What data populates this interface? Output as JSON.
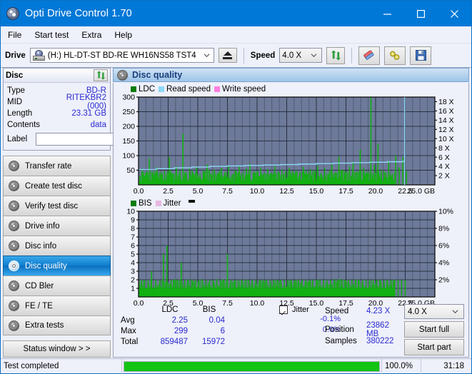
{
  "window": {
    "title": "Opti Drive Control 1.70",
    "icon": "disc-icon",
    "minimize": "minimize-icon",
    "maximize": "maximize-icon",
    "close": "close-icon"
  },
  "menu": {
    "items": [
      "File",
      "Start test",
      "Extra",
      "Help"
    ]
  },
  "toolbar": {
    "drive_label": "Drive",
    "drive_value": "(H:)  HL-DT-ST BD-RE  WH16NS58 TST4",
    "eject": "eject-icon",
    "speed_label": "Speed",
    "speed_value": "4.0 X",
    "refresh": "refresh-icon",
    "erase": "erase-icon",
    "tools": "tools-icon",
    "save": "save-icon"
  },
  "disc_panel": {
    "title": "Disc",
    "refresh": "refresh-icon",
    "rows": [
      {
        "key": "Type",
        "value": "BD-R"
      },
      {
        "key": "MID",
        "value": "RITEKBR2 (000)"
      },
      {
        "key": "Length",
        "value": "23.31 GB"
      },
      {
        "key": "Contents",
        "value": "data"
      }
    ],
    "label_key": "Label",
    "label_value": "",
    "label_placeholder": ""
  },
  "sidebar": {
    "items": [
      {
        "label": "Transfer rate",
        "active": false
      },
      {
        "label": "Create test disc",
        "active": false
      },
      {
        "label": "Verify test disc",
        "active": false
      },
      {
        "label": "Drive info",
        "active": false
      },
      {
        "label": "Disc info",
        "active": false
      },
      {
        "label": "Disc quality",
        "active": true
      },
      {
        "label": "CD Bler",
        "active": false
      },
      {
        "label": "FE / TE",
        "active": false
      },
      {
        "label": "Extra tests",
        "active": false
      }
    ],
    "status_button": "Status window > >"
  },
  "main": {
    "header_title": "Disc quality",
    "header_icon": "disc-icon"
  },
  "colors": {
    "ldc": "#12b012",
    "bis": "#12b012",
    "read_speed": "#8ed8f8",
    "write_speed": "#ff7fe0",
    "jitter": "#e8b8e0",
    "plot_bg": "#6d7a9a",
    "grid": "#3c4457",
    "accent": "#0078d7",
    "value_text": "#2a2ad0",
    "progress": "#13c413"
  },
  "chart_data": [
    {
      "type": "line",
      "title": "LDC (top chart)",
      "legend": [
        {
          "label": "LDC",
          "color": "#12b012"
        },
        {
          "label": "Read speed",
          "color": "#8ed8f8"
        },
        {
          "label": "Write speed",
          "color": "#ff7fe0"
        }
      ],
      "legend_position": "top-left",
      "grid": true,
      "xlabel": "GB",
      "x_ticks": [
        "0.0",
        "2.5",
        "5.0",
        "7.5",
        "10.0",
        "12.5",
        "15.0",
        "17.5",
        "20.0",
        "22.5",
        "25.0 GB"
      ],
      "xlim": [
        0,
        25
      ],
      "ylabel": "LDC",
      "y_ticks": [
        "50",
        "100",
        "150",
        "200",
        "250",
        "300"
      ],
      "ylim": [
        0,
        300
      ],
      "y2label": "Speed",
      "y2_ticks": [
        "2 X",
        "4 X",
        "6 X",
        "8 X",
        "10 X",
        "12 X",
        "14 X",
        "16 X",
        "18 X"
      ],
      "y2lim": [
        0,
        19
      ],
      "series": [
        {
          "name": "LDC",
          "color": "#12b012",
          "baseline": 12,
          "spikes_x": [
            0.3,
            0.6,
            0.9,
            1.2,
            1.55,
            1.9,
            2.2,
            2.6,
            2.9,
            3.2,
            3.5,
            3.75,
            4.0,
            4.3,
            4.6,
            4.9,
            5.2,
            5.5,
            5.8,
            6.1,
            6.4,
            6.7,
            7.0,
            7.3,
            7.6,
            7.9,
            8.2,
            8.5,
            8.8,
            9.1,
            9.4,
            9.7,
            10.0,
            10.3,
            10.6,
            10.9,
            11.2,
            11.5,
            11.8,
            12.1,
            12.4,
            12.7,
            13.0,
            13.3,
            13.6,
            13.9,
            14.2,
            14.5,
            14.8,
            15.1,
            15.4,
            15.7,
            16.0,
            16.3,
            16.6,
            16.9,
            17.2,
            17.5,
            17.8,
            18.1,
            18.4,
            18.7,
            19.0,
            19.3,
            19.6,
            19.9,
            20.2,
            20.5,
            20.8,
            21.1,
            21.4,
            21.7,
            22.0,
            22.3,
            22.6
          ],
          "spikes_y": [
            55,
            38,
            90,
            42,
            60,
            35,
            48,
            95,
            40,
            62,
            50,
            175,
            38,
            55,
            42,
            60,
            35,
            46,
            70,
            40,
            52,
            38,
            58,
            44,
            66,
            36,
            50,
            62,
            40,
            56,
            72,
            38,
            48,
            60,
            42,
            55,
            38,
            64,
            46,
            52,
            40,
            58,
            36,
            50,
            44,
            62,
            38,
            54,
            42,
            66,
            40,
            58,
            36,
            70,
            44,
            96,
            52,
            40,
            62,
            78,
            46,
            120,
            58,
            40,
            299,
            68,
            140,
            50,
            44,
            82,
            38,
            100,
            60,
            95,
            48
          ],
          "max_spike": {
            "x": 19.6,
            "y": 299
          }
        },
        {
          "name": "Read speed",
          "color": "#8ed8f8",
          "x": [
            0.0,
            1.5,
            3.0,
            4.5,
            6.0,
            7.5,
            9.0,
            10.5,
            12.0,
            13.5,
            15.0,
            16.5,
            18.0,
            19.5,
            21.0,
            22.3,
            22.45,
            22.45
          ],
          "y_speed": [
            3.3,
            3.5,
            3.7,
            3.85,
            4.0,
            4.1,
            4.2,
            4.3,
            4.4,
            4.5,
            4.6,
            4.7,
            4.8,
            4.9,
            5.0,
            5.1,
            5.1,
            19.0
          ],
          "note": "rising stair-step, terminates in a vertical line at ~22.5 GB"
        }
      ]
    },
    {
      "type": "line",
      "title": "BIS (bottom chart)",
      "legend": [
        {
          "label": "BIS",
          "color": "#12b012"
        },
        {
          "label": "Jitter",
          "color": "#e8b8e0"
        }
      ],
      "legend_position": "top-left",
      "grid": true,
      "xlabel": "GB",
      "x_ticks": [
        "0.0",
        "2.5",
        "5.0",
        "7.5",
        "10.0",
        "12.5",
        "15.0",
        "17.5",
        "20.0",
        "22.5",
        "25.0 GB"
      ],
      "xlim": [
        0,
        25
      ],
      "ylabel": "BIS",
      "y_ticks": [
        "1",
        "2",
        "3",
        "4",
        "5",
        "6",
        "7",
        "8",
        "9",
        "10"
      ],
      "ylim": [
        0,
        10
      ],
      "y2label": "Jitter",
      "y2_ticks": [
        "2%",
        "4%",
        "6%",
        "8%",
        "10%"
      ],
      "y2lim": [
        0,
        10
      ],
      "series": [
        {
          "name": "BIS",
          "color": "#12b012",
          "baseline": 1,
          "spikes_x": [
            0.25,
            0.5,
            0.8,
            1.1,
            1.45,
            1.8,
            2.1,
            2.4,
            2.75,
            3.0,
            3.3,
            3.6,
            3.9,
            4.2,
            4.5,
            4.8,
            5.1,
            5.4,
            5.7,
            6.0,
            6.3,
            6.6,
            6.9,
            7.2,
            7.5,
            7.8,
            8.1,
            8.4,
            8.7,
            9.0,
            9.3,
            9.6,
            9.9,
            10.2,
            10.5,
            10.8,
            11.1,
            11.4,
            11.7,
            12.0,
            12.3,
            12.6,
            12.9,
            13.2,
            13.5,
            13.8,
            14.1,
            14.4,
            14.7,
            15.0,
            15.3,
            15.6,
            15.9,
            16.2,
            16.5,
            16.8,
            17.1,
            17.4,
            17.7,
            18.0,
            18.3,
            18.6,
            18.9,
            19.2,
            19.5,
            19.8,
            20.1,
            20.4,
            20.7,
            21.0,
            21.3,
            21.6,
            21.9,
            22.2,
            22.5
          ],
          "spikes_y": [
            2,
            2,
            2,
            3,
            2,
            2,
            5,
            6,
            2,
            2,
            2,
            4,
            2,
            2,
            2,
            2,
            2,
            2,
            2,
            2,
            2,
            2,
            2,
            2,
            5,
            2,
            2,
            2,
            2,
            2,
            2,
            2,
            2,
            2,
            2,
            2,
            2,
            2,
            2,
            2,
            2,
            2,
            2,
            2,
            2,
            2,
            2,
            2,
            2,
            2,
            2,
            2,
            2,
            2,
            2,
            2,
            2,
            2,
            2,
            2,
            2,
            2,
            2,
            2,
            2,
            2,
            2,
            2,
            2,
            2,
            2,
            2,
            2,
            2,
            2
          ],
          "max_spike": {
            "x": 2.4,
            "y": 6
          }
        },
        {
          "name": "Jitter",
          "color": "#e8b8e0",
          "values": []
        }
      ]
    }
  ],
  "stats": {
    "columns": [
      "",
      "LDC",
      "BIS",
      "Jitter"
    ],
    "jitter_checkbox_checked": true,
    "jitter_label": "Jitter",
    "rows": [
      {
        "label": "Avg",
        "ldc": "2.25",
        "bis": "0.04",
        "jitter": "-0.1%"
      },
      {
        "label": "Max",
        "ldc": "299",
        "bis": "6",
        "jitter": "0.0%"
      },
      {
        "label": "Total",
        "ldc": "859487",
        "bis": "15972",
        "jitter": ""
      }
    ]
  },
  "run_panel": {
    "speed_label": "Speed",
    "speed_value": "4.23 X",
    "position_label": "Position",
    "position_value": "23862 MB",
    "samples_label": "Samples",
    "samples_value": "380222",
    "speed_select": "4.0 X",
    "start_full": "Start full",
    "start_part": "Start part"
  },
  "statusbar": {
    "message": "Test completed",
    "progress_percent": 100,
    "progress_text": "100.0%",
    "elapsed": "31:18"
  }
}
